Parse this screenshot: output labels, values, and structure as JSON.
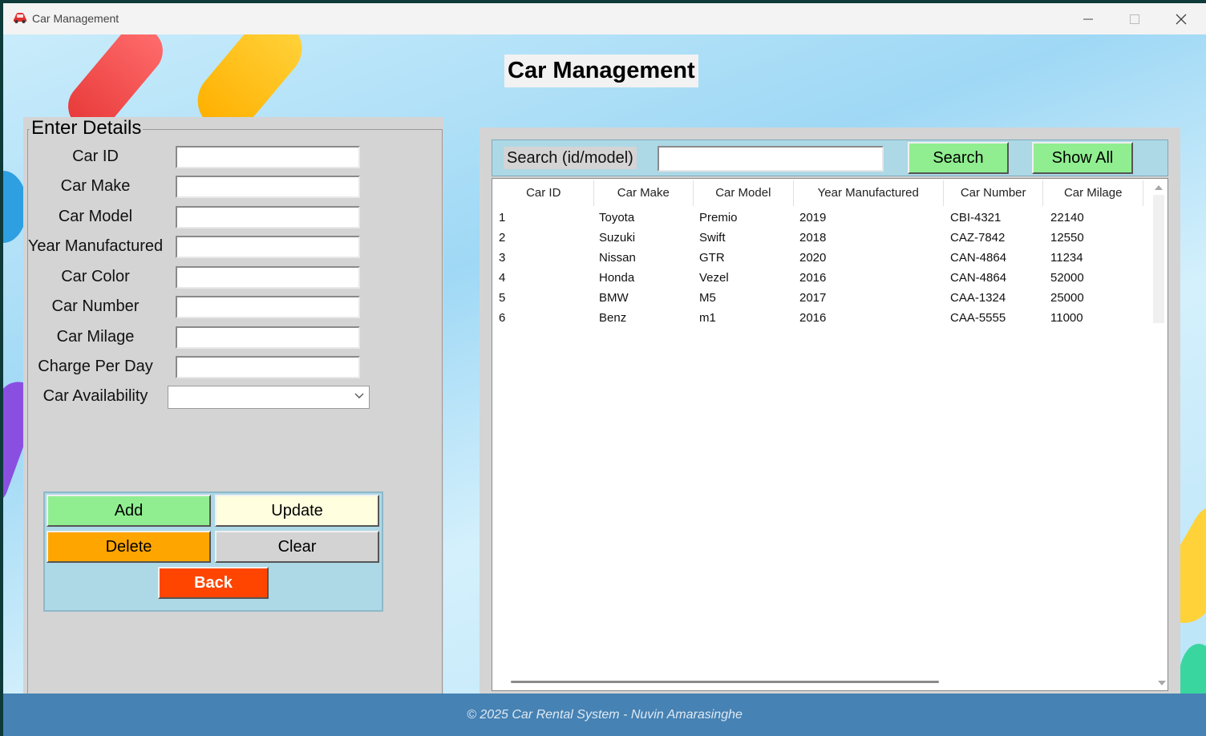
{
  "window": {
    "title": "Car Management",
    "icon": "car-icon"
  },
  "heading": "Car Management",
  "form": {
    "legend": "Enter Details",
    "fields": [
      {
        "label": "Car ID",
        "value": ""
      },
      {
        "label": "Car Make",
        "value": ""
      },
      {
        "label": "Car Model",
        "value": ""
      },
      {
        "label": "Year Manufactured",
        "value": ""
      },
      {
        "label": "Car Color",
        "value": ""
      },
      {
        "label": "Car Number",
        "value": ""
      },
      {
        "label": "Car Milage",
        "value": ""
      },
      {
        "label": "Charge Per Day",
        "value": ""
      }
    ],
    "availability": {
      "label": "Car Availability",
      "value": ""
    }
  },
  "buttons": {
    "add": "Add",
    "update": "Update",
    "delete": "Delete",
    "clear": "Clear",
    "back": "Back"
  },
  "search": {
    "label": "Search (id/model)",
    "value": "",
    "search_button": "Search",
    "show_all_button": "Show All"
  },
  "table": {
    "columns": [
      "Car ID",
      "Car Make",
      "Car Model",
      "Year Manufactured",
      "Car Number",
      "Car Milage"
    ],
    "rows": [
      [
        "1",
        "Toyota",
        "Premio",
        "2019",
        "CBI-4321",
        "22140"
      ],
      [
        "2",
        "Suzuki",
        "Swift",
        "2018",
        "CAZ-7842",
        "12550"
      ],
      [
        "3",
        "Nissan",
        "GTR",
        "2020",
        "CAN-4864",
        "11234"
      ],
      [
        "4",
        "Honda",
        "Vezel",
        "2016",
        "CAN-4864",
        "52000"
      ],
      [
        "5",
        "BMW",
        "M5",
        "2017",
        "CAA-1324",
        "25000"
      ],
      [
        "6",
        "Benz",
        "m1",
        "2016",
        "CAA-5555",
        "11000"
      ]
    ]
  },
  "footer": "© 2025 Car Rental System - Nuvin Amarasinghe",
  "colors": {
    "add": "#90ee90",
    "update": "#ffffe0",
    "delete": "#ffa500",
    "clear": "#d3d3d3",
    "back": "#ff4500",
    "button_panel": "#add8e6",
    "footer": "#4682b4",
    "panel": "#d4d4d4"
  }
}
